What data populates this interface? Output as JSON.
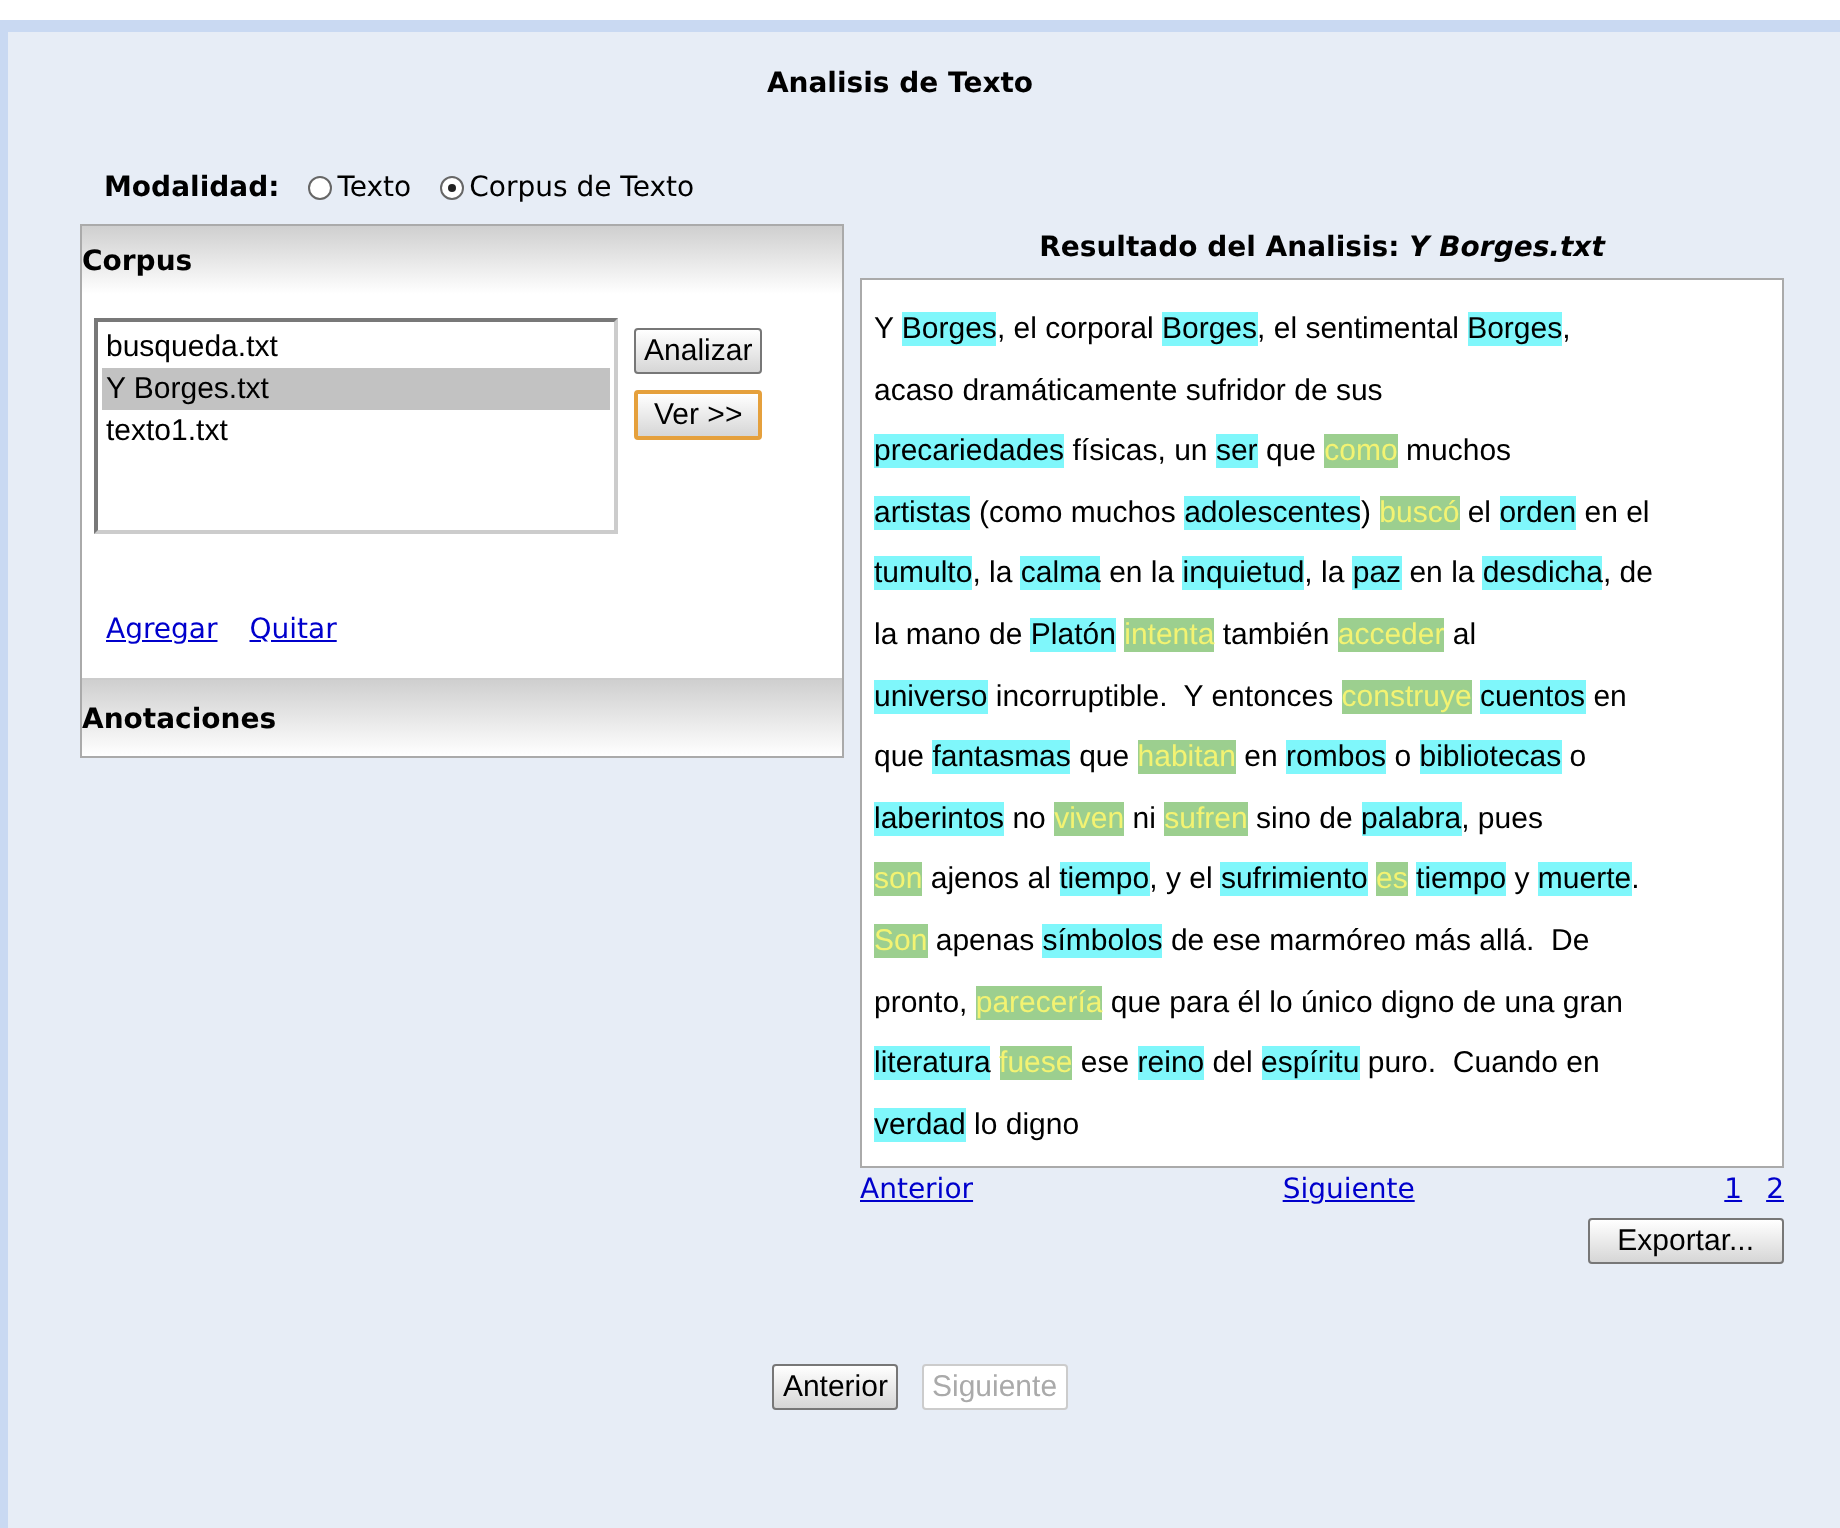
{
  "title": "Analisis de Texto",
  "mode": {
    "label": "Modalidad:",
    "options": [
      {
        "label": "Texto",
        "selected": false
      },
      {
        "label": "Corpus de Texto",
        "selected": true
      }
    ]
  },
  "corpus": {
    "title": "Corpus",
    "files": [
      {
        "label": "busqueda.txt",
        "selected": false
      },
      {
        "label": "Y Borges.txt",
        "selected": true
      },
      {
        "label": "texto1.txt",
        "selected": false
      }
    ],
    "buttons": [
      {
        "label": "Analizar",
        "focused": false
      },
      {
        "label": "Ver >>",
        "focused": true
      }
    ],
    "links": [
      "Agregar",
      "Quitar"
    ]
  },
  "annotations": {
    "title": "Anotaciones"
  },
  "result": {
    "heading": "Resultado del Analisis: *Y Borges.txt*",
    "lines": [
      [
        {
          "kind": "plain",
          "text": "Y "
        },
        {
          "kind": "noun",
          "text": "Borges"
        },
        {
          "kind": "plain",
          "text": ", el corporal "
        },
        {
          "kind": "noun",
          "text": "Borges"
        },
        {
          "kind": "plain",
          "text": ", el sentimental "
        },
        {
          "kind": "noun",
          "text": "Borges"
        },
        {
          "kind": "plain",
          "text": ","
        }
      ],
      [
        {
          "kind": "plain",
          "text": "acaso dramáticamente sufridor de sus"
        }
      ],
      [
        {
          "kind": "noun",
          "text": "precariedades"
        },
        {
          "kind": "plain",
          "text": " físicas, un "
        },
        {
          "kind": "noun",
          "text": "ser"
        },
        {
          "kind": "plain",
          "text": " que "
        },
        {
          "kind": "verb",
          "text": "como"
        },
        {
          "kind": "plain",
          "text": " muchos"
        }
      ],
      [
        {
          "kind": "noun",
          "text": "artistas"
        },
        {
          "kind": "plain",
          "text": " (como muchos "
        },
        {
          "kind": "noun",
          "text": "adolescentes"
        },
        {
          "kind": "plain",
          "text": ") "
        },
        {
          "kind": "verb",
          "text": "buscó"
        },
        {
          "kind": "plain",
          "text": " el "
        },
        {
          "kind": "noun",
          "text": "orden"
        },
        {
          "kind": "plain",
          "text": " en el"
        }
      ],
      [
        {
          "kind": "noun",
          "text": "tumulto"
        },
        {
          "kind": "plain",
          "text": ", la "
        },
        {
          "kind": "noun",
          "text": "calma"
        },
        {
          "kind": "plain",
          "text": " en la "
        },
        {
          "kind": "noun",
          "text": "inquietud"
        },
        {
          "kind": "plain",
          "text": ", la "
        },
        {
          "kind": "noun",
          "text": "paz"
        },
        {
          "kind": "plain",
          "text": " en la "
        },
        {
          "kind": "noun",
          "text": "desdicha"
        },
        {
          "kind": "plain",
          "text": ", de"
        }
      ],
      [
        {
          "kind": "plain",
          "text": "la mano de "
        },
        {
          "kind": "noun",
          "text": "Platón"
        },
        {
          "kind": "verb",
          "text": "intenta"
        },
        {
          "kind": "plain",
          "text": " también "
        },
        {
          "kind": "verb",
          "text": "acceder"
        },
        {
          "kind": "plain",
          "text": " al"
        }
      ],
      [
        {
          "kind": "noun",
          "text": "universo"
        },
        {
          "kind": "plain",
          "text": " incorruptible.  Y entonces "
        },
        {
          "kind": "verb",
          "text": "construye"
        },
        {
          "kind": "noun",
          "text": "cuentos"
        },
        {
          "kind": "plain",
          "text": " en"
        }
      ],
      [
        {
          "kind": "plain",
          "text": "que "
        },
        {
          "kind": "noun",
          "text": "fantasmas"
        },
        {
          "kind": "plain",
          "text": " que "
        },
        {
          "kind": "verb",
          "text": "habitan"
        },
        {
          "kind": "plain",
          "text": " en "
        },
        {
          "kind": "noun",
          "text": "rombos"
        },
        {
          "kind": "plain",
          "text": " o "
        },
        {
          "kind": "noun",
          "text": "bibliotecas"
        },
        {
          "kind": "plain",
          "text": " o"
        }
      ],
      [
        {
          "kind": "noun",
          "text": "laberintos"
        },
        {
          "kind": "plain",
          "text": " no "
        },
        {
          "kind": "verb",
          "text": "viven"
        },
        {
          "kind": "plain",
          "text": " ni "
        },
        {
          "kind": "verb",
          "text": "sufren"
        },
        {
          "kind": "plain",
          "text": " sino de "
        },
        {
          "kind": "noun",
          "text": "palabra"
        },
        {
          "kind": "plain",
          "text": ", pues"
        }
      ],
      [
        {
          "kind": "verb",
          "text": "son"
        },
        {
          "kind": "plain",
          "text": " ajenos al "
        },
        {
          "kind": "noun",
          "text": "tiempo"
        },
        {
          "kind": "plain",
          "text": ", y el "
        },
        {
          "kind": "noun",
          "text": "sufrimiento"
        },
        {
          "kind": "verb",
          "text": "es"
        },
        {
          "kind": "noun",
          "text": "tiempo"
        },
        {
          "kind": "plain",
          "text": " y "
        },
        {
          "kind": "noun",
          "text": "muerte"
        },
        {
          "kind": "plain",
          "text": "."
        }
      ],
      [
        {
          "kind": "verb",
          "text": "Son"
        },
        {
          "kind": "plain",
          "text": " apenas "
        },
        {
          "kind": "noun",
          "text": "símbolos"
        },
        {
          "kind": "plain",
          "text": " de ese marmóreo más allá.  De"
        }
      ],
      [
        {
          "kind": "plain",
          "text": "pronto, "
        },
        {
          "kind": "verb",
          "text": "parecería"
        },
        {
          "kind": "plain",
          "text": " que para él lo único digno de una gran"
        }
      ],
      [
        {
          "kind": "noun",
          "text": "literatura"
        },
        {
          "kind": "verb",
          "text": "fuese"
        },
        {
          "kind": "plain",
          "text": " ese "
        },
        {
          "kind": "noun",
          "text": "reino"
        },
        {
          "kind": "plain",
          "text": " del "
        },
        {
          "kind": "noun",
          "text": "espíritu"
        },
        {
          "kind": "plain",
          "text": " puro.  Cuando en"
        }
      ],
      [
        {
          "kind": "noun",
          "text": "verdad"
        },
        {
          "kind": "plain",
          "text": " lo digno"
        }
      ]
    ],
    "prev_link": "Anterior",
    "next_link": "Siguiente",
    "pages": [
      "1",
      "2"
    ],
    "export_button": "Exportar..."
  },
  "footer": [
    {
      "label": "Anterior",
      "disabled": false
    },
    {
      "label": "Siguiente",
      "disabled": true
    }
  ]
}
